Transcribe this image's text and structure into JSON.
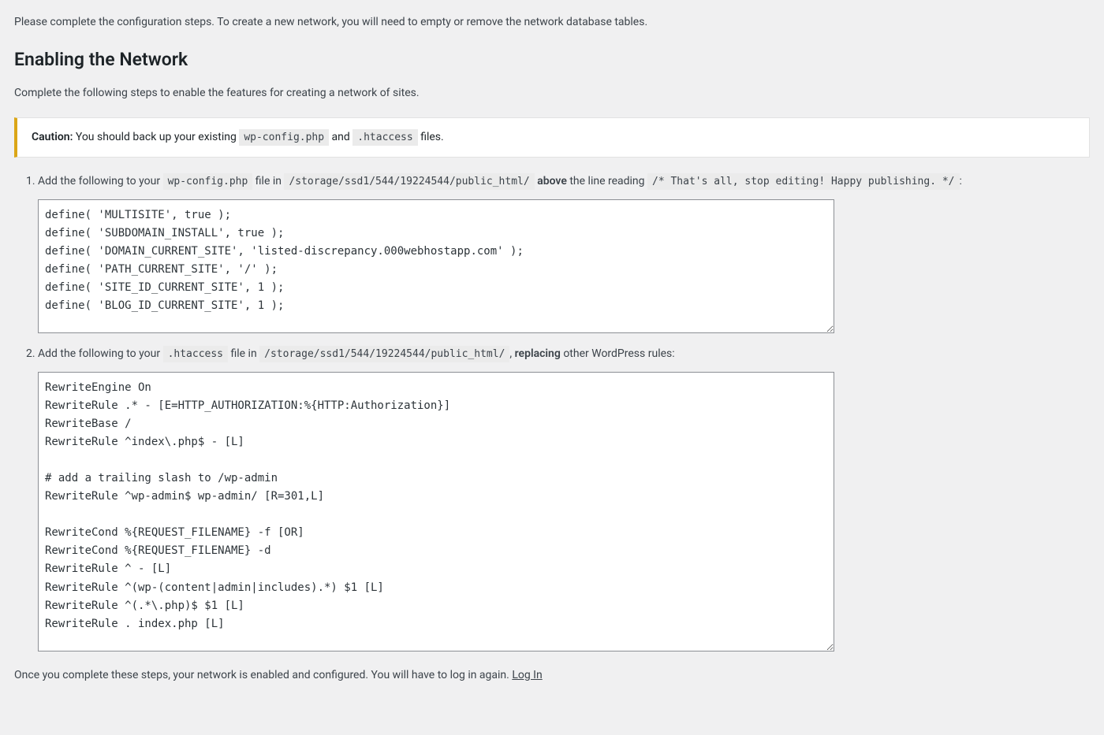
{
  "intro": "Please complete the configuration steps. To create a new network, you will need to empty or remove the network database tables.",
  "heading": "Enabling the Network",
  "subtitle": "Complete the following steps to enable the features for creating a network of sites.",
  "caution": {
    "label": "Caution:",
    "text1": " You should back up your existing ",
    "code1": "wp-config.php",
    "text2": " and ",
    "code2": ".htaccess",
    "text3": " files."
  },
  "step1": {
    "text1": "Add the following to your ",
    "code1": "wp-config.php",
    "text2": " file in ",
    "code2": "/storage/ssd1/544/19224544/public_html/",
    "text3": " ",
    "bold1": "above",
    "text4": " the line reading ",
    "code3": "/* That's all, stop editing! Happy publishing. */",
    "text5": ":",
    "textarea": "define( 'MULTISITE', true );\ndefine( 'SUBDOMAIN_INSTALL', true );\ndefine( 'DOMAIN_CURRENT_SITE', 'listed-discrepancy.000webhostapp.com' );\ndefine( 'PATH_CURRENT_SITE', '/' );\ndefine( 'SITE_ID_CURRENT_SITE', 1 );\ndefine( 'BLOG_ID_CURRENT_SITE', 1 );"
  },
  "step2": {
    "text1": "Add the following to your ",
    "code1": ".htaccess",
    "text2": " file in ",
    "code2": "/storage/ssd1/544/19224544/public_html/",
    "text3": ", ",
    "bold1": "replacing",
    "text4": " other WordPress rules:",
    "textarea": "RewriteEngine On\nRewriteRule .* - [E=HTTP_AUTHORIZATION:%{HTTP:Authorization}]\nRewriteBase /\nRewriteRule ^index\\.php$ - [L]\n\n# add a trailing slash to /wp-admin\nRewriteRule ^wp-admin$ wp-admin/ [R=301,L]\n\nRewriteCond %{REQUEST_FILENAME} -f [OR]\nRewriteCond %{REQUEST_FILENAME} -d\nRewriteRule ^ - [L]\nRewriteRule ^(wp-(content|admin|includes).*) $1 [L]\nRewriteRule ^(.*\\.php)$ $1 [L]\nRewriteRule . index.php [L]"
  },
  "outro": {
    "text": "Once you complete these steps, your network is enabled and configured. You will have to log in again. ",
    "link": "Log In"
  }
}
